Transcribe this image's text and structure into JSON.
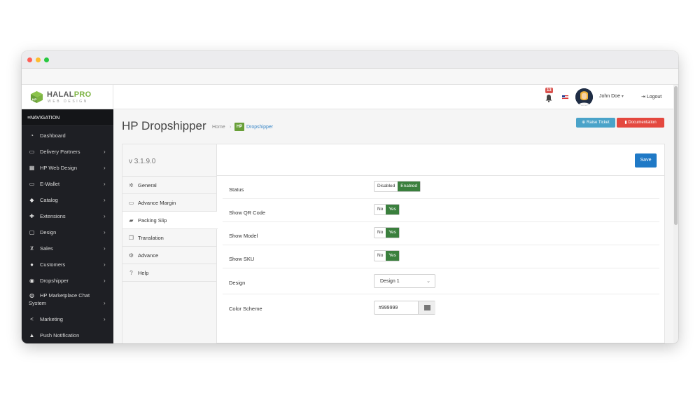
{
  "brand": {
    "name_main": "HALAL",
    "name_accent": "PRO",
    "tagline": "WEB DESIGN",
    "accent_color": "#7cb342"
  },
  "header": {
    "notification_count": "13",
    "user_name": "John Doe",
    "user_caret": "▾",
    "logout_label": "Logout"
  },
  "sidebar": {
    "header": "NAVIGATION",
    "items": [
      {
        "label": "Dashboard",
        "icon": "dashboard-icon",
        "chevron": ""
      },
      {
        "label": "Delivery Partners",
        "icon": "credit-card-icon",
        "chevron": "›"
      },
      {
        "label": "HP Web Design",
        "icon": "windows-icon",
        "chevron": "›"
      },
      {
        "label": "E-Wallet",
        "icon": "credit-card-icon",
        "chevron": "›"
      },
      {
        "label": "Catalog",
        "icon": "tag-icon",
        "chevron": "›"
      },
      {
        "label": "Extensions",
        "icon": "puzzle-icon",
        "chevron": "›"
      },
      {
        "label": "Design",
        "icon": "desktop-icon",
        "chevron": "›"
      },
      {
        "label": "Sales",
        "icon": "cart-icon",
        "chevron": "›"
      },
      {
        "label": "Customers",
        "icon": "user-icon",
        "chevron": "›"
      },
      {
        "label": "Dropshipper",
        "icon": "users-icon",
        "chevron": "›"
      },
      {
        "label": "HP Marketplace Chat",
        "label2": "System",
        "icon": "chat-icon",
        "chevron": "›"
      },
      {
        "label": "Marketing",
        "icon": "share-icon",
        "chevron": "›"
      },
      {
        "label": "Push Notification",
        "icon": "bell-icon",
        "chevron": ""
      }
    ]
  },
  "page": {
    "title": "HP Dropshipper",
    "breadcrumb_home": "Home",
    "breadcrumb_sep": "›",
    "breadcrumb_logo": "HP",
    "breadcrumb_current": "Dropshipper",
    "raise_ticket_label": "Raise Ticket",
    "documentation_label": "Documentation",
    "raise_ticket_color": "#4aa3c9",
    "documentation_color": "#e4483f"
  },
  "panel": {
    "version": "v 3.1.9.0",
    "save_label": "Save",
    "tabs": [
      {
        "label": "General",
        "icon": "gear-icon",
        "active": false
      },
      {
        "label": "Advance Margin",
        "icon": "credit-card-icon",
        "active": false
      },
      {
        "label": "Packing Slip",
        "icon": "truck-icon",
        "active": true
      },
      {
        "label": "Translation",
        "icon": "copy-icon",
        "active": false
      },
      {
        "label": "Advance",
        "icon": "gears-icon",
        "active": false
      },
      {
        "label": "Help",
        "icon": "question-icon",
        "active": false
      }
    ],
    "settings": {
      "status": {
        "label": "Status",
        "off": "Disabled",
        "on": "Enabled",
        "value": "Enabled"
      },
      "show_qr": {
        "label": "Show QR Code",
        "off": "No",
        "on": "Yes",
        "value": "Yes"
      },
      "show_model": {
        "label": "Show Model",
        "off": "No",
        "on": "Yes",
        "value": "Yes"
      },
      "show_sku": {
        "label": "Show SKU",
        "off": "No",
        "on": "Yes",
        "value": "Yes"
      },
      "design": {
        "label": "Design",
        "value": "Design 1"
      },
      "color_scheme": {
        "label": "Color Scheme",
        "value": "#999999",
        "swatch": "#777777"
      }
    },
    "toggle_on_color": "#3a7f3d",
    "save_color": "#1f79c6"
  }
}
